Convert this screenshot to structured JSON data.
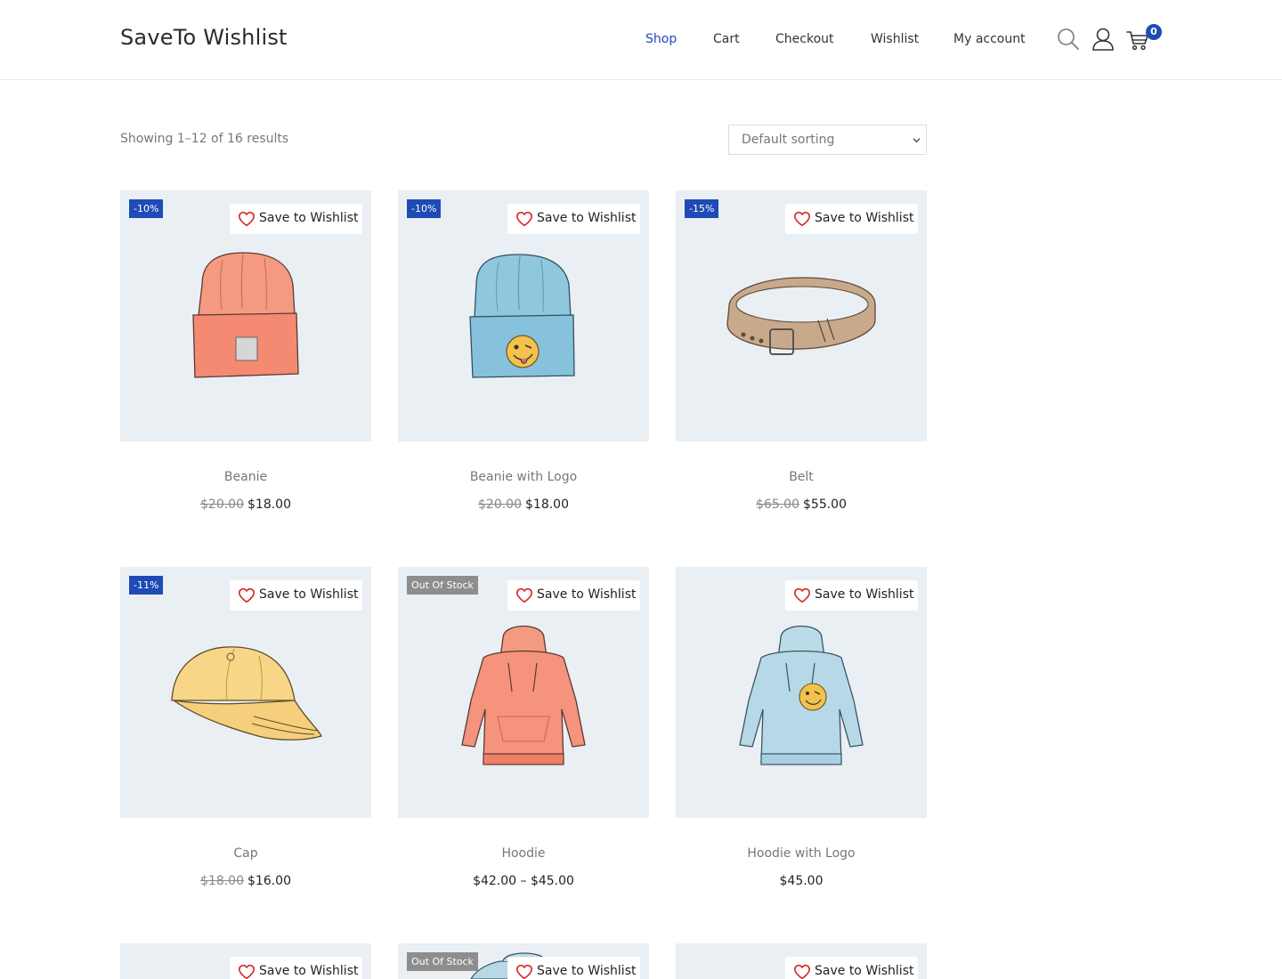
{
  "site": {
    "title": "SaveTo Wishlist"
  },
  "nav": [
    {
      "label": "Shop",
      "active": true
    },
    {
      "label": "Cart"
    },
    {
      "label": "Checkout"
    },
    {
      "label": "Wishlist"
    },
    {
      "label": "My account"
    }
  ],
  "header_icons": [
    "search-icon",
    "user-icon",
    "cart-icon"
  ],
  "cart": {
    "count": "0"
  },
  "shop": {
    "result_count": "Showing 1–12 of 16 results",
    "sort_selected": "Default sorting"
  },
  "wishlist_label": "Save to Wishlist",
  "colors": {
    "accent": "#1e4bb5",
    "out_of_stock": "#8d8d8d",
    "thumb_bg": "#eaeff4",
    "heart": "#d62828"
  },
  "products": [
    {
      "name": "Beanie",
      "badge": "-10%",
      "badge_type": "sale",
      "regular_price": "$20.00",
      "price": "$18.00"
    },
    {
      "name": "Beanie with Logo",
      "badge": "-10%",
      "badge_type": "sale",
      "regular_price": "$20.00",
      "price": "$18.00"
    },
    {
      "name": "Belt",
      "badge": "-15%",
      "badge_type": "sale",
      "regular_price": "$65.00",
      "price": "$55.00"
    },
    {
      "name": "Cap",
      "badge": "-11%",
      "badge_type": "sale",
      "regular_price": "$18.00",
      "price": "$16.00"
    },
    {
      "name": "Hoodie",
      "badge": "Out Of Stock",
      "badge_type": "oos",
      "regular_price": "",
      "price": "$42.00 – $45.00"
    },
    {
      "name": "Hoodie with Logo",
      "badge": "",
      "badge_type": "",
      "regular_price": "",
      "price": "$45.00"
    },
    {
      "badge": "",
      "badge_type": ""
    },
    {
      "badge": "Out Of Stock",
      "badge_type": "oos"
    },
    {
      "badge": "",
      "badge_type": ""
    }
  ]
}
